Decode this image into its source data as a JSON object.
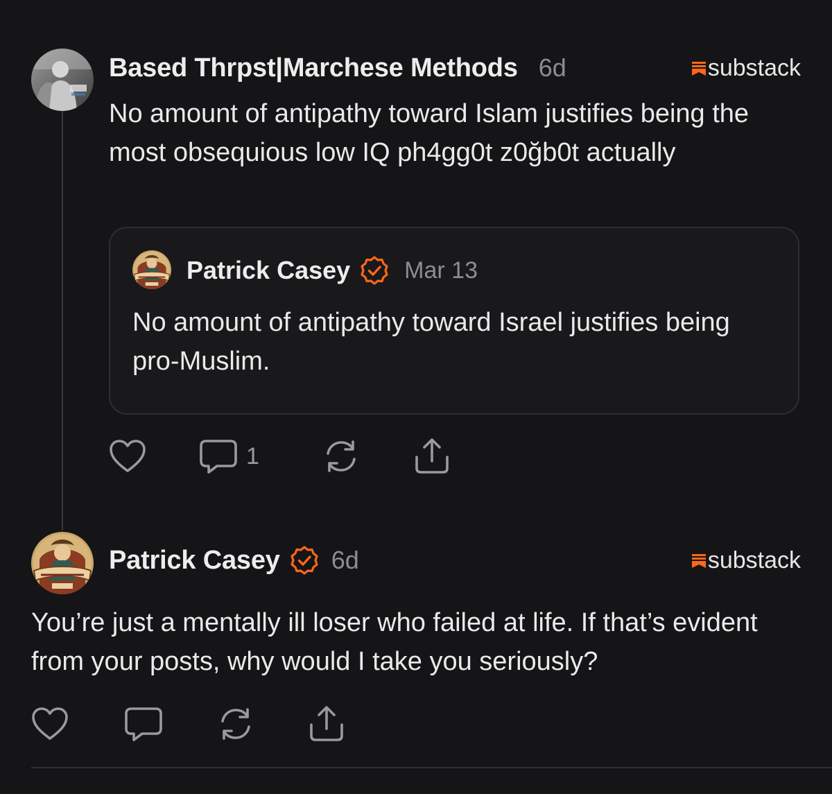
{
  "colors": {
    "background": "#151517",
    "accent_orange": "#FF6719",
    "muted_text": "#8d8d91",
    "card_border": "#2e2e31"
  },
  "post1": {
    "author": "Based Thrpst|Marchese Methods",
    "time": "6d",
    "brand": "substack",
    "avatar_icon": "photo-avatar",
    "text": "No amount of antipathy toward Islam justifies being the most obsequious low IQ ph4gg0t z0ğb0t actually",
    "quote": {
      "author": "Patrick Casey",
      "verified_icon": "verified-badge-icon",
      "time": "Mar 13",
      "text": "No amount of antipathy toward Israel justifies being pro-Muslim."
    },
    "actions": {
      "like_icon": "heart-icon",
      "comment_icon": "comment-icon",
      "comment_count": "1",
      "restack_icon": "restack-icon",
      "share_icon": "share-icon"
    }
  },
  "post2": {
    "author": "Patrick Casey",
    "verified_icon": "verified-badge-icon",
    "time": "6d",
    "brand": "substack",
    "avatar_icon": "restoring-order-avatar",
    "text": "You’re just a mentally ill loser who failed at life. If that’s evident from your posts, why would I take you seriously?",
    "actions": {
      "like_icon": "heart-icon",
      "comment_icon": "comment-icon",
      "restack_icon": "restack-icon",
      "share_icon": "share-icon"
    }
  }
}
